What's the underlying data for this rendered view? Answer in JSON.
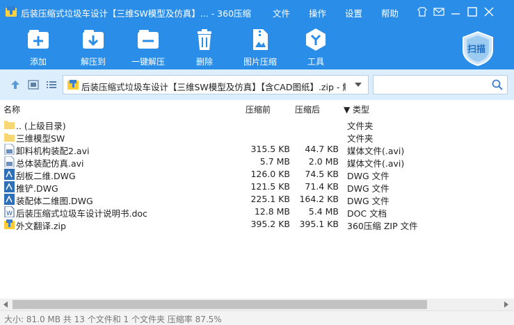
{
  "window": {
    "title": "后装压缩式垃圾车设计【三维SW模型及仿真】... - 360压缩",
    "menu": [
      "文件",
      "操作",
      "设置",
      "帮助"
    ]
  },
  "toolbar": {
    "add": "添加",
    "extract_to": "解压到",
    "one_click_extract": "一键解压",
    "delete": "删除",
    "image_compress": "图片压缩",
    "tools": "工具",
    "scan": "扫描"
  },
  "address": {
    "path": "后装压缩式垃圾车设计【三维SW模型及仿真】【含CAD图纸】.zip - 解",
    "search_placeholder": ""
  },
  "columns": {
    "name": "名称",
    "size": "压缩前",
    "packed": "压缩后",
    "type": "▼ 类型"
  },
  "files": [
    {
      "icon": "folder-up-icon",
      "name": ".. (上级目录)",
      "size": "",
      "packed": "",
      "type": "文件夹"
    },
    {
      "icon": "folder-icon",
      "name": "三维模型SW",
      "size": "",
      "packed": "",
      "type": "文件夹"
    },
    {
      "icon": "video-file-icon",
      "name": "卸料机构装配2.avi",
      "size": "315.5 KB",
      "packed": "44.7 KB",
      "type": "媒体文件(.avi)"
    },
    {
      "icon": "video-file-icon",
      "name": "总体装配仿真.avi",
      "size": "5.7 MB",
      "packed": "2.0 MB",
      "type": "媒体文件(.avi)"
    },
    {
      "icon": "dwg-file-icon",
      "name": "刮板二维.DWG",
      "size": "126.0 KB",
      "packed": "74.5 KB",
      "type": "DWG 文件"
    },
    {
      "icon": "dwg-file-icon",
      "name": "推铲.DWG",
      "size": "121.5 KB",
      "packed": "71.4 KB",
      "type": "DWG 文件"
    },
    {
      "icon": "dwg-file-icon",
      "name": "装配体二维图.DWG",
      "size": "225.1 KB",
      "packed": "164.2 KB",
      "type": "DWG 文件"
    },
    {
      "icon": "doc-file-icon",
      "name": "后装压缩式垃圾车设计说明书.doc",
      "size": "12.8 MB",
      "packed": "5.4 MB",
      "type": "DOC 文档"
    },
    {
      "icon": "zip-file-icon",
      "name": "外文翻译.zip",
      "size": "395.2 KB",
      "packed": "395.1 KB",
      "type": "360压缩 ZIP 文件"
    }
  ],
  "status": "大小: 81.0 MB 共 13 个文件和 1 个文件夹 压缩率 87.5%"
}
